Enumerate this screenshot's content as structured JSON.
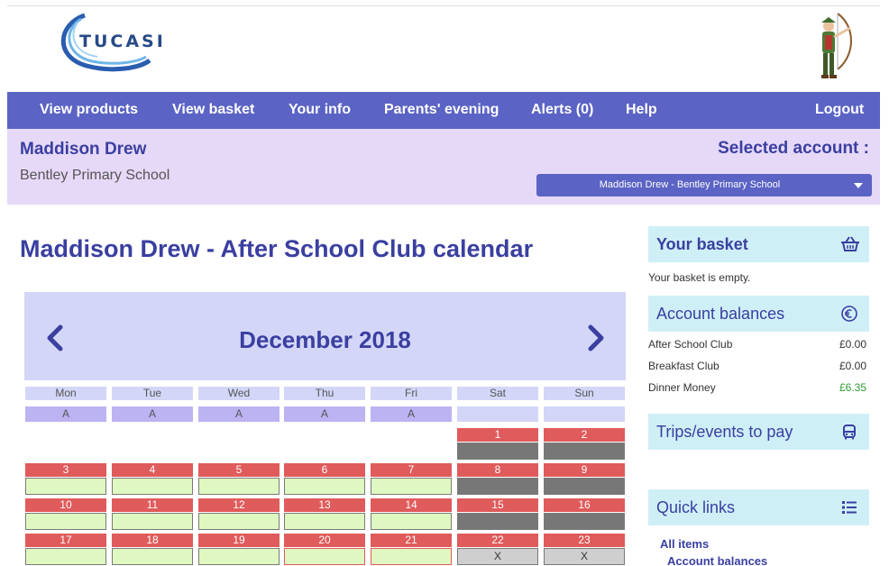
{
  "header": {
    "logo_text": "TUCASI"
  },
  "nav": {
    "items": [
      {
        "label": "View products"
      },
      {
        "label": "View basket"
      },
      {
        "label": "Your info"
      },
      {
        "label": "Parents' evening"
      },
      {
        "label": "Alerts (0)"
      },
      {
        "label": "Help"
      },
      {
        "label": "Logout"
      }
    ]
  },
  "account": {
    "name": "Maddison Drew",
    "school": "Bentley Primary School",
    "selected_label": "Selected account :",
    "selected_value": "Maddison Drew - Bentley Primary School"
  },
  "page": {
    "title": "Maddison Drew - After School Club calendar"
  },
  "calendar": {
    "month": "December 2018",
    "days_of_week": [
      "Mon",
      "Tue",
      "Wed",
      "Thu",
      "Fri",
      "Sat",
      "Sun"
    ],
    "availability": [
      "A",
      "A",
      "A",
      "A",
      "A",
      "",
      ""
    ],
    "weeks": [
      [
        null,
        null,
        null,
        null,
        null,
        {
          "num": "1",
          "state": "weekend",
          "mark": ""
        },
        {
          "num": "2",
          "state": "weekend",
          "mark": ""
        }
      ],
      [
        {
          "num": "3",
          "state": "open",
          "mark": ""
        },
        {
          "num": "4",
          "state": "open",
          "mark": ""
        },
        {
          "num": "5",
          "state": "open",
          "mark": ""
        },
        {
          "num": "6",
          "state": "open",
          "mark": ""
        },
        {
          "num": "7",
          "state": "open",
          "mark": ""
        },
        {
          "num": "8",
          "state": "weekend",
          "mark": ""
        },
        {
          "num": "9",
          "state": "weekend",
          "mark": ""
        }
      ],
      [
        {
          "num": "10",
          "state": "open",
          "mark": ""
        },
        {
          "num": "11",
          "state": "open",
          "mark": ""
        },
        {
          "num": "12",
          "state": "open",
          "mark": ""
        },
        {
          "num": "13",
          "state": "open",
          "mark": ""
        },
        {
          "num": "14",
          "state": "open",
          "mark": ""
        },
        {
          "num": "15",
          "state": "weekend",
          "mark": ""
        },
        {
          "num": "16",
          "state": "weekend",
          "mark": ""
        }
      ],
      [
        {
          "num": "17",
          "state": "open",
          "mark": ""
        },
        {
          "num": "18",
          "state": "open",
          "mark": ""
        },
        {
          "num": "19",
          "state": "open",
          "mark": ""
        },
        {
          "num": "20",
          "state": "flagged",
          "mark": ""
        },
        {
          "num": "21",
          "state": "flagged",
          "mark": ""
        },
        {
          "num": "22",
          "state": "closed",
          "mark": "X"
        },
        {
          "num": "23",
          "state": "closed",
          "mark": "X"
        }
      ]
    ]
  },
  "sidebar": {
    "basket": {
      "title": "Your basket",
      "empty_text": "Your basket is empty.",
      "icon": "basket-icon"
    },
    "balances": {
      "title": "Account balances",
      "icon": "euro-icon",
      "rows": [
        {
          "name": "After School Club",
          "amount": "£0.00",
          "status": "zero"
        },
        {
          "name": "Breakfast Club",
          "amount": "£0.00",
          "status": "zero"
        },
        {
          "name": "Dinner Money",
          "amount": "£6.35",
          "status": "positive"
        }
      ]
    },
    "trips": {
      "title": "Trips/events to pay",
      "icon": "bus-icon"
    },
    "quick_links": {
      "title": "Quick links",
      "icon": "list-icon",
      "items": [
        {
          "label": "All items"
        },
        {
          "label": "Account balances"
        }
      ]
    }
  },
  "colors": {
    "nav": "#5b63c4",
    "account_bar": "#e6d8f7",
    "heading": "#3a3fa0",
    "day_number": "#e05b5b",
    "open_slot": "#dff7c0",
    "weekend_slot": "#777777",
    "sidebar_head": "#cfeff7",
    "positive_balance": "#2f9a2f"
  }
}
